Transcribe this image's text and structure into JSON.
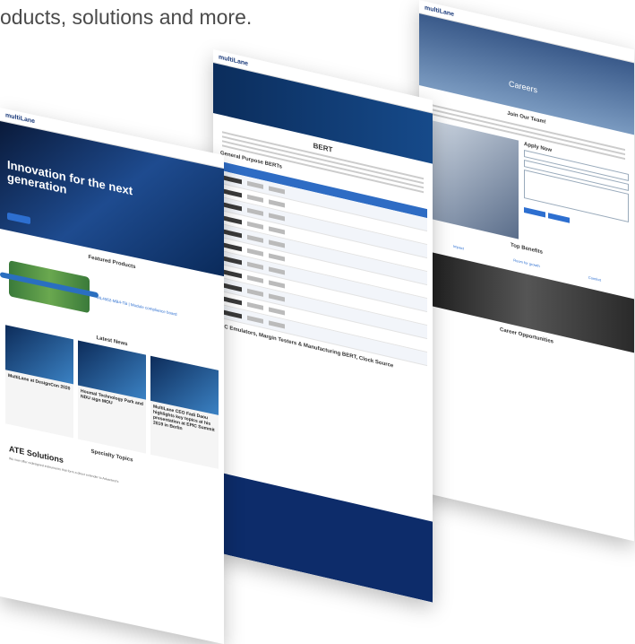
{
  "headline": "oducts, solutions and more.",
  "left_page": {
    "logo": "multiLane",
    "hero_title": "Innovation for the next generation",
    "featured_title": "Featured Products",
    "product_link": "ML4062-MB4-TB | Module compliance board",
    "news_title": "Latest News",
    "news": [
      {
        "title": "MultiLane at DesignCon 2020"
      },
      {
        "title": "Houmal Technology Park and NDU sign MOU"
      },
      {
        "title": "MultiLane CEO Fadi Daou highlights key topics at his presentation at EPIC Summit 2019 in Berlin"
      }
    ],
    "specialty_title": "Specialty Topics",
    "ate_title": "ATE Solutions",
    "ate_text": "We now offer redesigned instruments that form a direct extender to Advantest's"
  },
  "middle_page": {
    "logo": "multiLane",
    "section_label": "BERT",
    "table_title": "General Purpose BERTs",
    "footer_links": "AC Emulators, Margin Testers & Manufacturing BERT, Clock Source"
  },
  "right_page": {
    "logo": "multiLane",
    "hero_title": "Careers",
    "join_title": "Join Our Team!",
    "apply_title": "Apply Now",
    "benefits_title": "Top Benefits",
    "benefits": [
      "Impact",
      "Room for growth",
      "Comfort"
    ],
    "career_op_title": "Career Opportunities"
  }
}
